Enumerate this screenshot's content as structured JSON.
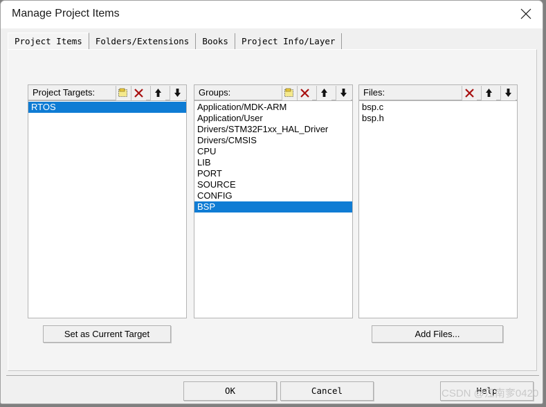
{
  "window": {
    "title": "Manage Project Items",
    "close_icon": "close-icon"
  },
  "tabs": [
    {
      "label": "Project Items",
      "selected": true
    },
    {
      "label": "Folders/Extensions",
      "selected": false
    },
    {
      "label": "Books",
      "selected": false
    },
    {
      "label": "Project Info/Layer",
      "selected": false
    }
  ],
  "panels": {
    "targets": {
      "header_label": "Project Targets:",
      "toolbar": [
        {
          "icon": "new-item-icon",
          "title": "New (Insert)"
        },
        {
          "icon": "delete-x-icon",
          "title": "Remove Item"
        },
        {
          "icon": "move-up-arrow-icon",
          "title": "Move Up"
        },
        {
          "icon": "move-down-arrow-icon",
          "title": "Move Down"
        }
      ],
      "items": [
        {
          "label": "RTOS",
          "selected": true
        }
      ]
    },
    "groups": {
      "header_label": "Groups:",
      "toolbar": [
        {
          "icon": "new-item-icon",
          "title": "New (Insert)"
        },
        {
          "icon": "delete-x-icon",
          "title": "Remove Item"
        },
        {
          "icon": "move-up-arrow-icon",
          "title": "Move Up"
        },
        {
          "icon": "move-down-arrow-icon",
          "title": "Move Down"
        }
      ],
      "items": [
        {
          "label": "Application/MDK-ARM",
          "selected": false
        },
        {
          "label": "Application/User",
          "selected": false
        },
        {
          "label": "Drivers/STM32F1xx_HAL_Driver",
          "selected": false
        },
        {
          "label": "Drivers/CMSIS",
          "selected": false
        },
        {
          "label": "CPU",
          "selected": false
        },
        {
          "label": "LIB",
          "selected": false
        },
        {
          "label": "PORT",
          "selected": false
        },
        {
          "label": "SOURCE",
          "selected": false
        },
        {
          "label": "CONFIG",
          "selected": false
        },
        {
          "label": "BSP",
          "selected": true
        }
      ]
    },
    "files": {
      "header_label": "Files:",
      "toolbar": [
        {
          "icon": "delete-x-icon",
          "title": "Remove Item"
        },
        {
          "icon": "move-up-arrow-icon",
          "title": "Move Up"
        },
        {
          "icon": "move-down-arrow-icon",
          "title": "Move Down"
        }
      ],
      "items": [
        {
          "label": "bsp.c",
          "selected": false
        },
        {
          "label": "bsp.h",
          "selected": false
        }
      ]
    }
  },
  "buttons": {
    "set_current_target": "Set as Current Target",
    "add_files": "Add Files...",
    "ok": "OK",
    "cancel": "Cancel",
    "help": "Help"
  },
  "watermark": {
    "text": "CSDN @江南奓0420"
  },
  "colors": {
    "selection_blue": "#0f7cd4",
    "dialog_face": "#f0f0f0",
    "panel_face": "#f4f4f4",
    "list_background": "#ffffff",
    "delete_icon_red": "#a81010",
    "new_icon_yellow": "#e8d84a"
  }
}
